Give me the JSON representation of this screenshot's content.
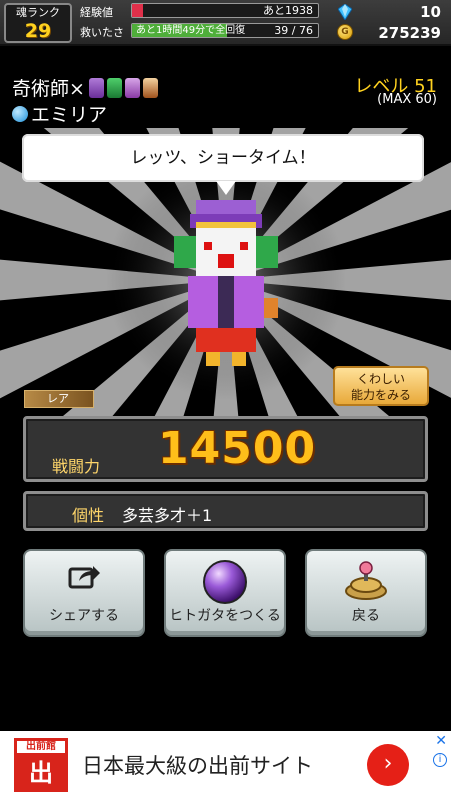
{
  "status": {
    "rank_label": "魂ランク",
    "rank_value": "29",
    "exp_label": "経験値",
    "exp_text": "あと1938",
    "exp_fraction": 0.06,
    "rescue_label": "救いたさ",
    "rescue_sub": "あと1時間49分で全回復",
    "rescue_text": "39 / 76",
    "rescue_fraction": 0.51,
    "gems": "10",
    "coins": "275239",
    "coin_symbol": "G"
  },
  "character": {
    "job": "奇術師×",
    "name": "エミリア",
    "level": "レベル 51",
    "level_max": "(MAX 60)",
    "speech": "レッツ、ショータイム！",
    "rarity": "レア",
    "detail_button": "くわしい\n能力をみる",
    "power_label": "戦闘力",
    "power_value": "14500",
    "trait_label": "個性",
    "trait_value": "多芸多才＋1"
  },
  "actions": [
    {
      "label": "シェアする",
      "icon": "share-icon"
    },
    {
      "label": "ヒトガタをつくる",
      "icon": "purple-orb-icon"
    },
    {
      "label": "戻る",
      "icon": "return-icon"
    }
  ],
  "ad": {
    "logo_top": "出前館",
    "logo_mark": "出",
    "text": "日本最大級の出前サイト",
    "go": "›",
    "close": "✕",
    "info": "i"
  },
  "colors": {
    "accent_gold": "#ffd21f",
    "power_orange": "#ffbe1a",
    "exp_bar": "#e0304a",
    "rescue_bar": "#4fae3a",
    "ad_red": "#e52017"
  }
}
